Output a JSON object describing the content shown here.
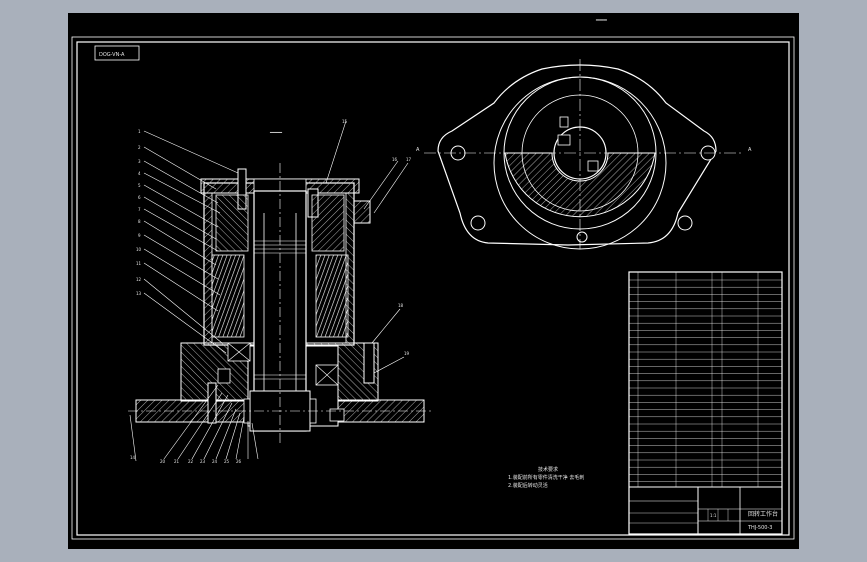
{
  "viewport": {
    "background": "#000000",
    "outer_bg": "#a9b0bb",
    "line_color": "#ffffff"
  },
  "sheet": {
    "code_box": "DOG-VN-A",
    "top_right_marker": "━━━",
    "scale_mark": "━━━━"
  },
  "section": {
    "part_numbers": [
      "1",
      "2",
      "3",
      "4",
      "5",
      "6",
      "7",
      "8",
      "9",
      "10",
      "11",
      "12",
      "13",
      "14",
      "15",
      "16",
      "17",
      "18",
      "19",
      "20",
      "21",
      "22",
      "23",
      "24",
      "25",
      "26"
    ]
  },
  "plan_view": {
    "axis_mark_left": "A",
    "axis_mark_right": "A"
  },
  "notes": {
    "heading": "技术要求",
    "line1": "1.装配前所有零件清洗干净 去毛刺",
    "line2": "2.装配后转动灵活"
  },
  "title_block": {
    "drawing_title": "回转工作台",
    "drawing_number": "THJ-500-3",
    "company": "",
    "scale": "1:1",
    "material": ""
  }
}
